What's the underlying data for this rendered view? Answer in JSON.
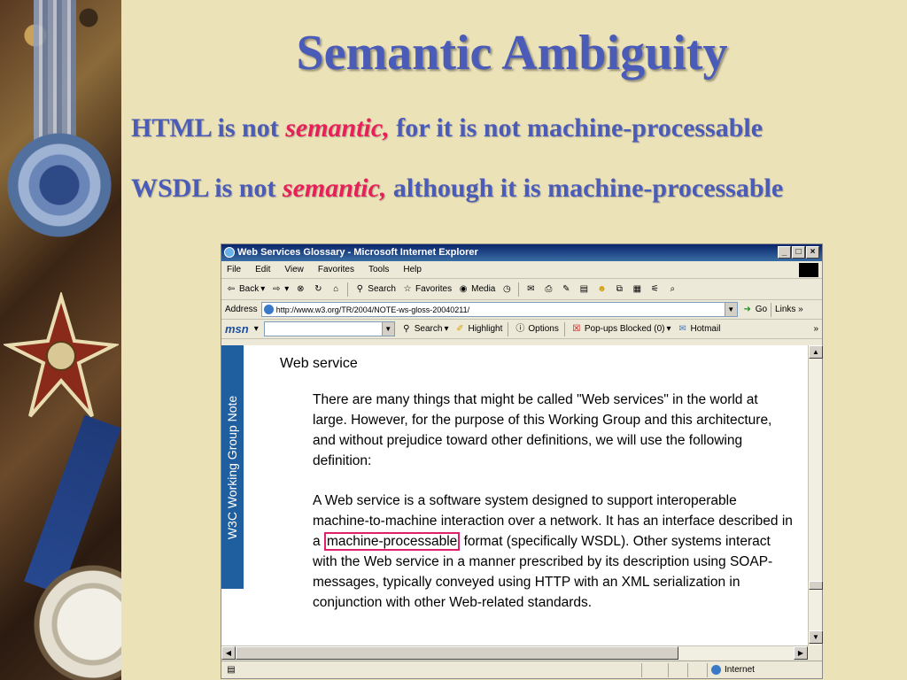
{
  "slide": {
    "title": "Semantic Ambiguity",
    "line1": {
      "before": "HTML is not ",
      "em": "semantic,",
      "after": " for it is not machine-processable"
    },
    "line2": {
      "before": "WSDL is not ",
      "em": "semantic,",
      "after": " although it is machine-processable"
    }
  },
  "browser": {
    "window_title": "Web Services Glossary - Microsoft Internet Explorer",
    "window_buttons": [
      "_",
      "□",
      "×"
    ],
    "menu": [
      "File",
      "Edit",
      "View",
      "Favorites",
      "Tools",
      "Help"
    ],
    "toolbar": {
      "back": "Back",
      "search": "Search",
      "favorites": "Favorites",
      "media": "Media"
    },
    "address_label": "Address",
    "address_url": "http://www.w3.org/TR/2004/NOTE-ws-gloss-20040211/",
    "go_label": "Go",
    "links_label": "Links",
    "msn": {
      "logo": "msn",
      "search": "Search",
      "highlight": "Highlight",
      "options": "Options",
      "popups": "Pop-ups Blocked (0)",
      "hotmail": "Hotmail"
    },
    "page": {
      "side_banner": "W3C Working Group Note",
      "heading": "Web service",
      "paragraph1": "There are many things that might be called \"Web services\" in the world at large. However, for the purpose of this Working Group and this architecture, and without prejudice toward other definitions, we will use the following definition:",
      "paragraph2_before": "A Web service is a software system designed to support interoperable machine-to-machine interaction over a network. It has an interface described in a ",
      "paragraph2_highlight": "machine-processable",
      "paragraph2_after": " format (specifically WSDL). Other systems interact with the Web service in a manner prescribed by its description using SOAP-messages, typically conveyed using HTTP with an XML serialization in conjunction with other Web-related standards."
    },
    "status": {
      "zone": "Internet"
    }
  }
}
